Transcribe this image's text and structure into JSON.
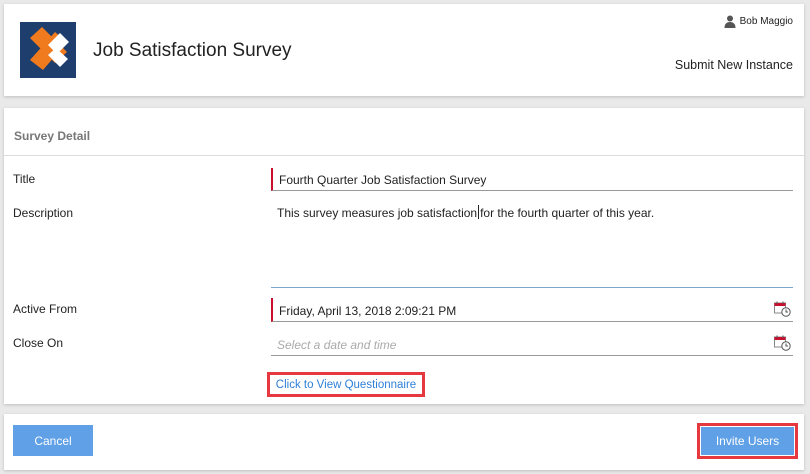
{
  "header": {
    "app_title": "Job Satisfaction Survey",
    "user_name": "Bob Maggio",
    "submit_link": "Submit New Instance",
    "logo_colors": {
      "background": "#1e3e6e",
      "orange": "#f07a1e",
      "white": "#ffffff"
    }
  },
  "detail": {
    "section_title": "Survey Detail",
    "fields": {
      "title": {
        "label": "Title",
        "value": "Fourth Quarter Job Satisfaction Survey"
      },
      "description": {
        "label": "Description",
        "value_before_caret": "This survey measures job satisfaction",
        "value_after_caret": "for the fourth quarter of this year."
      },
      "active_from": {
        "label": "Active From",
        "value": "Friday, April 13, 2018 2:09:21 PM",
        "icon": "calendar-clock-icon"
      },
      "close_on": {
        "label": "Close On",
        "placeholder": "Select a date and time",
        "icon": "calendar-clock-icon"
      }
    },
    "questionnaire_link": "Click to View Questionnaire"
  },
  "footer": {
    "cancel_label": "Cancel",
    "invite_label": "Invite Users"
  },
  "colors": {
    "accent_button": "#5fa0e6",
    "highlight_border": "#e5393f",
    "required_marker": "#c8102e",
    "link": "#2e7fd8"
  }
}
